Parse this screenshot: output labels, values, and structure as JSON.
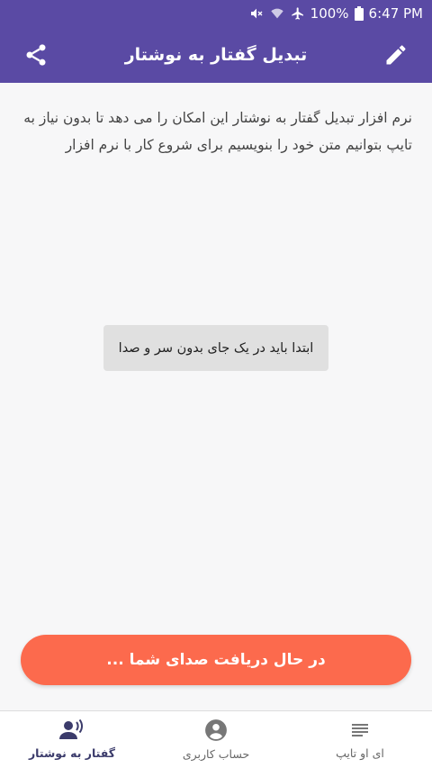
{
  "status_bar": {
    "battery_percent": "100%",
    "time": "6:47 PM",
    "icons": [
      "mute-icon",
      "wifi-icon",
      "airplane-icon",
      "battery-icon"
    ]
  },
  "app_bar": {
    "title": "تبدیل گفتار به نوشتار",
    "left_icon": "share-icon",
    "right_icon": "edit-icon",
    "background": "#5a4aa4"
  },
  "main": {
    "description": "نرم افزار تبدیل گفتار به نوشتار این امکان را می دهد تا بدون نیاز به تایپ بتوانیم متن خود را بنویسیم برای شروع کار با نرم افزار",
    "toast": "ابتدا باید در یک جای بدون سر و صدا",
    "record_button_label": "در حال دریافت صدای شما ...",
    "record_button_color": "#fc6a4d"
  },
  "bottom_nav": {
    "items": [
      {
        "label": "گفتار به نوشتار",
        "icon": "voice-person-icon",
        "active": true
      },
      {
        "label": "حساب کاربری",
        "icon": "account-circle-icon",
        "active": false
      },
      {
        "label": "ای او تایپ",
        "icon": "notes-lines-icon",
        "active": false
      }
    ]
  }
}
